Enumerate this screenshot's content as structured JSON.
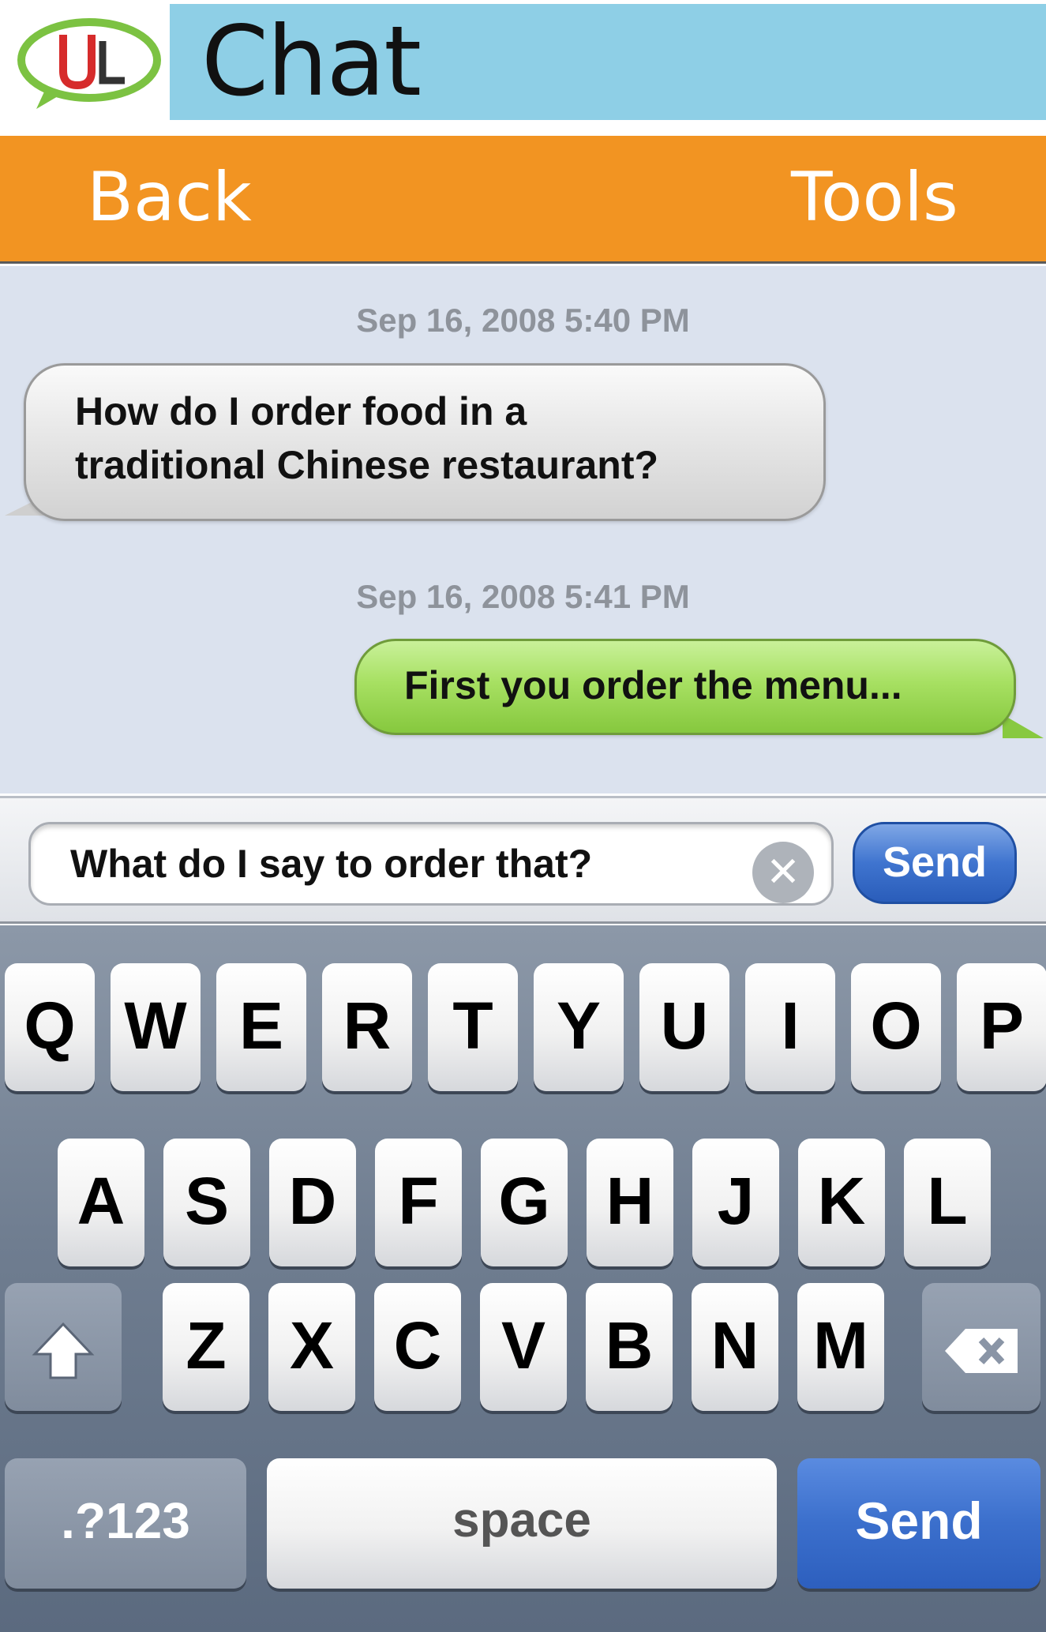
{
  "app": {
    "logo_text": "UL",
    "title": "Chat",
    "colors": {
      "title_bar": "#8ecfe6",
      "nav_bar": "#f29422",
      "chat_bg": "#dbe2ee"
    }
  },
  "nav": {
    "back_label": "Back",
    "tools_label": "Tools"
  },
  "messages": [
    {
      "timestamp": "Sep 16, 2008 5:40 PM",
      "text_line1": "How do I order food in a",
      "text_line2": "traditional Chinese restaurant?",
      "side": "incoming"
    },
    {
      "timestamp": "Sep 16, 2008 5:41 PM",
      "text": "First you order the menu...",
      "side": "outgoing"
    }
  ],
  "compose": {
    "value": "What do I say to order that?",
    "clear_icon": "clear-icon",
    "send_label": "Send"
  },
  "keyboard": {
    "row1": [
      "Q",
      "W",
      "E",
      "R",
      "T",
      "Y",
      "U",
      "I",
      "O",
      "P"
    ],
    "row2": [
      "A",
      "S",
      "D",
      "F",
      "G",
      "H",
      "J",
      "K",
      "L"
    ],
    "row3": [
      "Z",
      "X",
      "C",
      "V",
      "B",
      "N",
      "M"
    ],
    "shift_icon": "shift-icon",
    "backspace_icon": "backspace-icon",
    "numbers_label": ".?123",
    "space_label": "space",
    "send_label": "Send"
  }
}
